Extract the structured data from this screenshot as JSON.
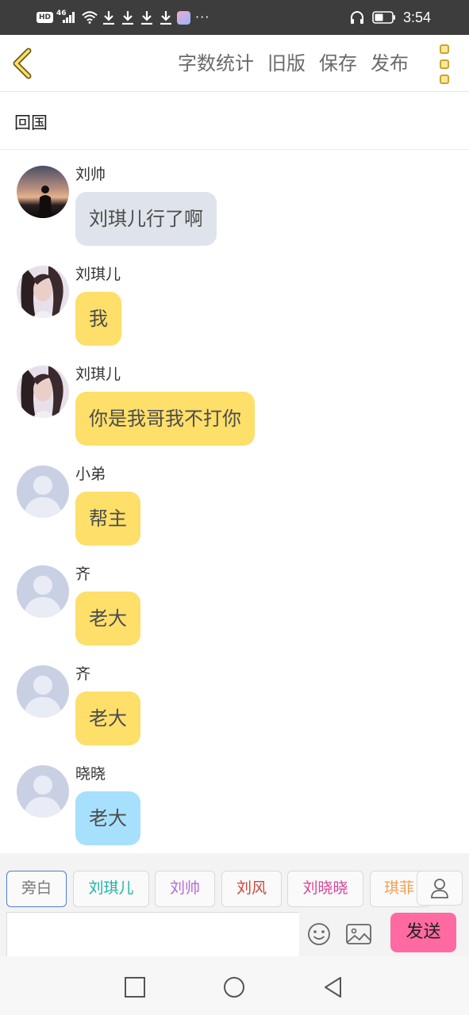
{
  "status_bar": {
    "hd": "HD",
    "network": "46",
    "time": "3:54",
    "more": "···"
  },
  "header": {
    "menu": [
      "字数统计",
      "旧版",
      "保存",
      "发布"
    ]
  },
  "story_title": "回国",
  "messages": [
    {
      "name": "刘帅",
      "text": "刘琪儿行了啊",
      "avatar": "photo-dusk-figure",
      "bubble_color": "#dfe4ec"
    },
    {
      "name": "刘琪儿",
      "text": "我",
      "avatar": "photo-girl-portrait",
      "bubble_color": "#fddf6a"
    },
    {
      "name": "刘琪儿",
      "text": "你是我哥我不打你",
      "avatar": "photo-girl-portrait",
      "bubble_color": "#fddf6a"
    },
    {
      "name": "小弟",
      "text": "帮主",
      "avatar": "default-user-silhouette",
      "bubble_color": "#fddf6a"
    },
    {
      "name": "齐",
      "text": "老大",
      "avatar": "default-user-silhouette",
      "bubble_color": "#fddf6a"
    },
    {
      "name": "齐",
      "text": "老大",
      "avatar": "default-user-silhouette",
      "bubble_color": "#fddf6a"
    },
    {
      "name": "晓晓",
      "text": "老大",
      "avatar": "default-user-silhouette",
      "bubble_color": "#a6e0fd"
    }
  ],
  "characters": [
    {
      "label": "旁白",
      "color": "#777777",
      "selected": true
    },
    {
      "label": "刘琪儿",
      "color": "#1fb3a8"
    },
    {
      "label": "刘帅",
      "color": "#b56ad9"
    },
    {
      "label": "刘风",
      "color": "#d2453a"
    },
    {
      "label": "刘晓晓",
      "color": "#d9439a"
    },
    {
      "label": "琪菲",
      "color": "#f0a050"
    }
  ],
  "composer": {
    "send_label": "发送",
    "input_value": ""
  },
  "colors": {
    "accent_yellow": "#fddf6a",
    "send_pink": "#ff6aa2",
    "selected_border": "#4a7fd1"
  }
}
